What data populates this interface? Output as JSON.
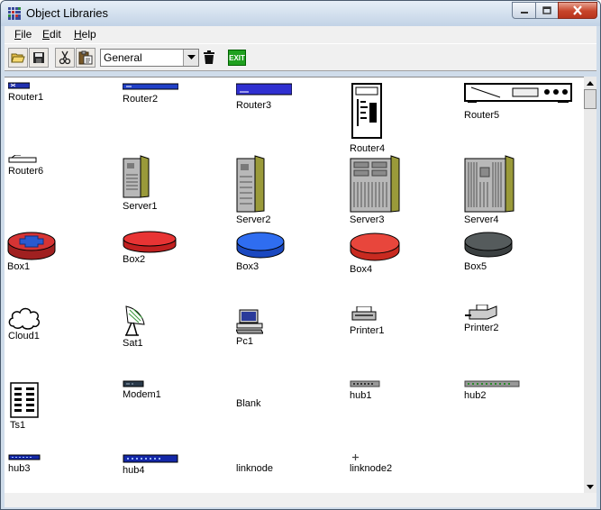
{
  "window": {
    "title": "Object Libraries",
    "icon": "grid-icon"
  },
  "menu": {
    "items": [
      {
        "label": "File",
        "accel": "F",
        "rest": "ile"
      },
      {
        "label": "Edit",
        "accel": "E",
        "rest": "dit"
      },
      {
        "label": "Help",
        "accel": "H",
        "rest": "elp"
      }
    ]
  },
  "toolbar": {
    "library": "General",
    "exit_label": "EXIT",
    "buttons": [
      "open-folder-icon",
      "save-icon",
      "cut-icon",
      "paste-icon",
      "trash-icon"
    ]
  },
  "objects": {
    "router1": "Router1",
    "router2": "Router2",
    "router3": "Router3",
    "router4": "Router4",
    "router5": "Router5",
    "router6": "Router6",
    "server1": "Server1",
    "server2": "Server2",
    "server3": "Server3",
    "server4": "Server4",
    "box1": "Box1",
    "box2": "Box2",
    "box3": "Box3",
    "box4": "Box4",
    "box5": "Box5",
    "cloud1": "Cloud1",
    "sat1": "Sat1",
    "pc1": "Pc1",
    "printer1": "Printer1",
    "printer2": "Printer2",
    "ts1": "Ts1",
    "modem1": "Modem1",
    "blank": "Blank",
    "hub1": "hub1",
    "hub2": "hub2",
    "hub3": "hub3",
    "hub4": "hub4",
    "linknode": "linknode",
    "linknode2": "linknode2"
  },
  "colors": {
    "box1": "#d63434",
    "box2": "#e83434",
    "box3": "#2f6df0",
    "box4": "#e8463c",
    "box5": "#555b5c",
    "rack": "#9a9a3a",
    "hub_blue": "#1428a8"
  }
}
